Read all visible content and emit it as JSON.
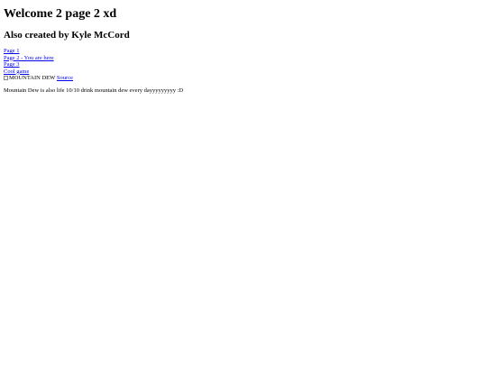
{
  "heading": {
    "title": "Welcome 2 page 2 xd",
    "subtitle": "Also created by Kyle McCord"
  },
  "nav": {
    "items": [
      {
        "label": "Page 1"
      },
      {
        "label": "Page 2 - You are here"
      },
      {
        "label": "Page 3"
      },
      {
        "label": "Cool game"
      }
    ]
  },
  "image": {
    "alt": "MOUNTAIN DEW",
    "icon": "broken-image-icon",
    "source_label": "Source"
  },
  "body": {
    "text": "Mountain Dew is also life 10/10 drink mountain dew every dayyyyyyyyy :D"
  },
  "colors": {
    "link": "#0000ee",
    "text": "#000000",
    "background": "#ffffff"
  }
}
